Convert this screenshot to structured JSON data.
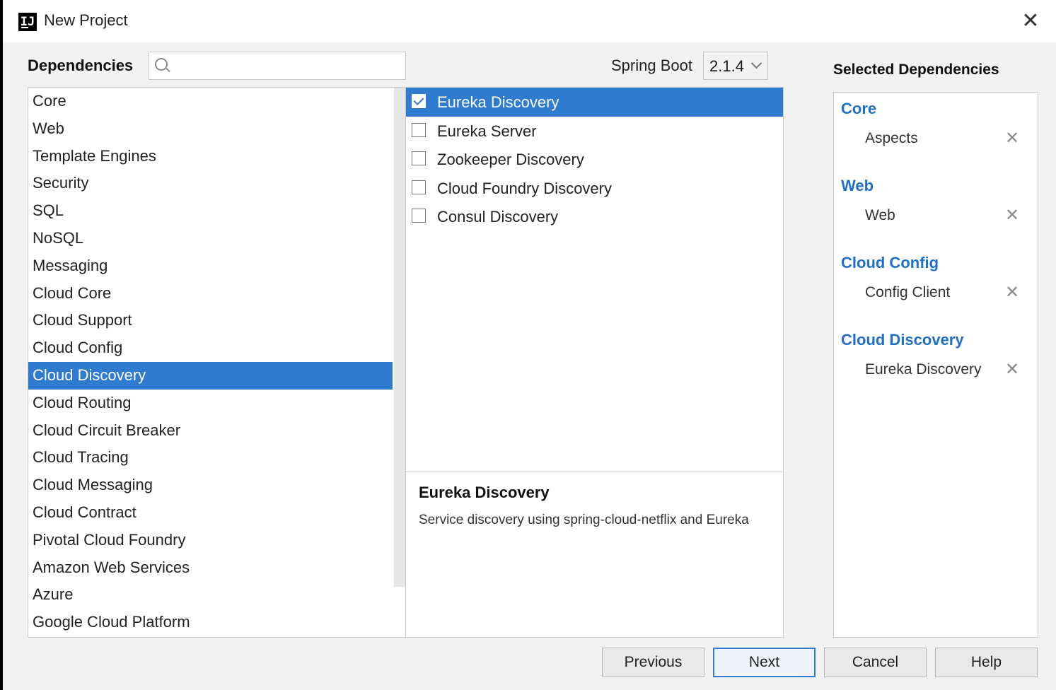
{
  "window": {
    "title": "New Project",
    "app_icon_text": "IJ",
    "close_glyph": "✕"
  },
  "dependencies": {
    "heading": "Dependencies",
    "search": {
      "value": "",
      "placeholder": ""
    },
    "categories": [
      "Core",
      "Web",
      "Template Engines",
      "Security",
      "SQL",
      "NoSQL",
      "Messaging",
      "Cloud Core",
      "Cloud Support",
      "Cloud Config",
      "Cloud Discovery",
      "Cloud Routing",
      "Cloud Circuit Breaker",
      "Cloud Tracing",
      "Cloud Messaging",
      "Cloud Contract",
      "Pivotal Cloud Foundry",
      "Amazon Web Services",
      "Azure",
      "Google Cloud Platform"
    ],
    "selected_category": "Cloud Discovery"
  },
  "spring_boot": {
    "label": "Spring Boot",
    "version": "2.1.4"
  },
  "dependency_items": [
    {
      "label": "Eureka Discovery",
      "checked": true,
      "selected": true
    },
    {
      "label": "Eureka Server",
      "checked": false,
      "selected": false
    },
    {
      "label": "Zookeeper Discovery",
      "checked": false,
      "selected": false
    },
    {
      "label": "Cloud Foundry Discovery",
      "checked": false,
      "selected": false
    },
    {
      "label": "Consul Discovery",
      "checked": false,
      "selected": false
    }
  ],
  "description": {
    "title": "Eureka Discovery",
    "text": "Service discovery using spring-cloud-netflix and Eureka"
  },
  "selected_dependencies": {
    "heading": "Selected Dependencies",
    "remove_glyph": "✕",
    "groups": [
      {
        "name": "Core",
        "items": [
          "Aspects"
        ]
      },
      {
        "name": "Web",
        "items": [
          "Web"
        ]
      },
      {
        "name": "Cloud Config",
        "items": [
          "Config Client"
        ]
      },
      {
        "name": "Cloud Discovery",
        "items": [
          "Eureka Discovery"
        ]
      }
    ]
  },
  "buttons": {
    "previous": "Previous",
    "next": "Next",
    "cancel": "Cancel",
    "help": "Help"
  },
  "colors": {
    "selection": "#2e7bd0",
    "group_heading": "#1f6fc9"
  }
}
